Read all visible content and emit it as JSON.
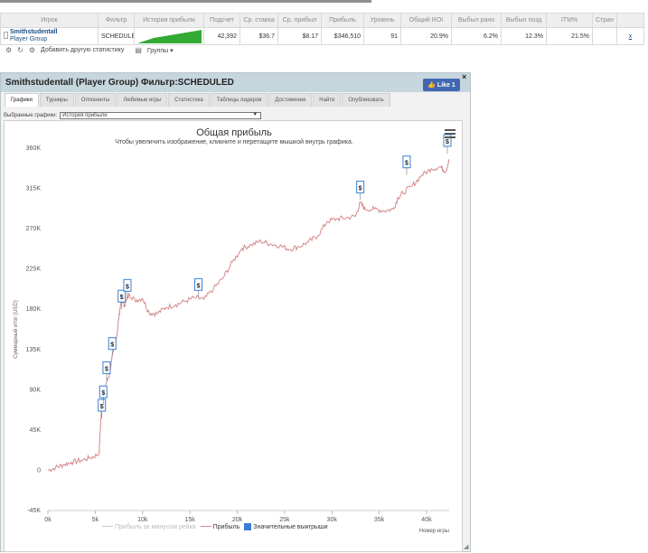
{
  "stats": {
    "headers": [
      "Игрок",
      "Фильтр",
      "История прибыли",
      "Подсчет",
      "Ср. ставка",
      "Ср. прибыл",
      "Прибыль",
      "Уровень",
      "Общий ROI",
      "Выбыл рано",
      "Выбыл позд",
      "ITM%",
      "Стран",
      ""
    ],
    "row": {
      "player_name": "Smithstudentall",
      "player_group": "Player Group",
      "filter": "SCHEDULED",
      "count": "42,392",
      "avg_stake": "$36.7",
      "avg_profit": "$8.17",
      "profit": "$346,510",
      "level": "91",
      "roi": "20.9%",
      "early": "6.2%",
      "late": "12.3%",
      "itm": "21.5%",
      "country": "",
      "x": "x"
    },
    "toolbar": {
      "add_label": "Добавить другую статистику",
      "groups_label": "Группы ▾"
    }
  },
  "popup": {
    "title": "Smithstudentall (Player Group) Фильтр:SCHEDULED",
    "like_label": "Like 1",
    "close": "×",
    "tabs": [
      "Графики",
      "Турниры",
      "Оппоненты",
      "Любимые игры",
      "Статистика",
      "Таблицы лидеров",
      "Достижения",
      "Найти",
      "Опубликовать"
    ],
    "active_tab": 0,
    "select_label": "Выбранные графики:",
    "select_value": "История прибыли"
  },
  "chart_data": {
    "type": "line",
    "title": "Общая прибыль",
    "subtitle": "Чтобы увеличить изображение, кликните и перетащите мышкой внутрь графика.",
    "ylabel": "Суммарный итог (USD)",
    "xlabel": "Номер игры",
    "xlim": [
      0,
      42392
    ],
    "ylim": [
      -45000,
      360000
    ],
    "x_ticks": [
      0,
      5000,
      10000,
      15000,
      20000,
      25000,
      30000,
      35000,
      40000
    ],
    "x_tick_labels": [
      "0k",
      "5k",
      "10k",
      "15k",
      "20k",
      "25k",
      "30k",
      "35k",
      "40k"
    ],
    "y_ticks": [
      -45000,
      0,
      45000,
      90000,
      135000,
      180000,
      225000,
      270000,
      315000,
      360000
    ],
    "y_tick_labels": [
      "-45K",
      "0",
      "45K",
      "90K",
      "135K",
      "180K",
      "225K",
      "270K",
      "315K",
      "360K"
    ],
    "grid": false,
    "legend_position": "bottom",
    "series": [
      {
        "name": "Прибыль за минусом рейка",
        "color": "#cccccc",
        "values": []
      },
      {
        "name": "Прибыль",
        "color": "#d48a8a",
        "x": [
          0,
          800,
          1600,
          2500,
          3500,
          4500,
          5400,
          5600,
          5800,
          6100,
          6500,
          6900,
          7300,
          7600,
          7800,
          8100,
          8600,
          9200,
          10000,
          10700,
          11500,
          12500,
          13500,
          14500,
          15500,
          16500,
          17500,
          18500,
          19500,
          20500,
          21500,
          22500,
          23500,
          24500,
          25500,
          26500,
          27500,
          28500,
          29500,
          30500,
          31500,
          32500,
          33000,
          33500,
          34500,
          35500,
          36500,
          37000,
          37500,
          38500,
          39500,
          40500,
          41500,
          42000,
          42392
        ],
        "values": [
          0,
          3000,
          6000,
          9000,
          11000,
          14000,
          18000,
          58000,
          80000,
          95000,
          108000,
          132000,
          152000,
          180000,
          192000,
          184000,
          197000,
          190000,
          192000,
          176000,
          175000,
          182000,
          185000,
          189000,
          193000,
          191000,
          203000,
          215000,
          233000,
          248000,
          252000,
          256000,
          253000,
          251000,
          247000,
          250000,
          255000,
          262000,
          278000,
          281000,
          282000,
          284000,
          299000,
          292000,
          292000,
          290000,
          292000,
          305000,
          310000,
          318000,
          330000,
          337000,
          339000,
          334000,
          346510
        ]
      },
      {
        "name": "Значительные выигрыши",
        "color": "#3a7fd5",
        "values": []
      }
    ],
    "markers": [
      {
        "x": 5700,
        "y": 58000,
        "label": "$"
      },
      {
        "x": 5850,
        "y": 73000,
        "label": "$"
      },
      {
        "x": 6200,
        "y": 100000,
        "label": "$"
      },
      {
        "x": 6800,
        "y": 127000,
        "label": "$"
      },
      {
        "x": 7800,
        "y": 180000,
        "label": "$"
      },
      {
        "x": 8400,
        "y": 192000,
        "label": "$"
      },
      {
        "x": 15900,
        "y": 193000,
        "label": "$"
      },
      {
        "x": 33000,
        "y": 302000,
        "label": "$"
      },
      {
        "x": 37900,
        "y": 330000,
        "label": "$"
      },
      {
        "x": 42200,
        "y": 354000,
        "label": "$"
      }
    ]
  }
}
